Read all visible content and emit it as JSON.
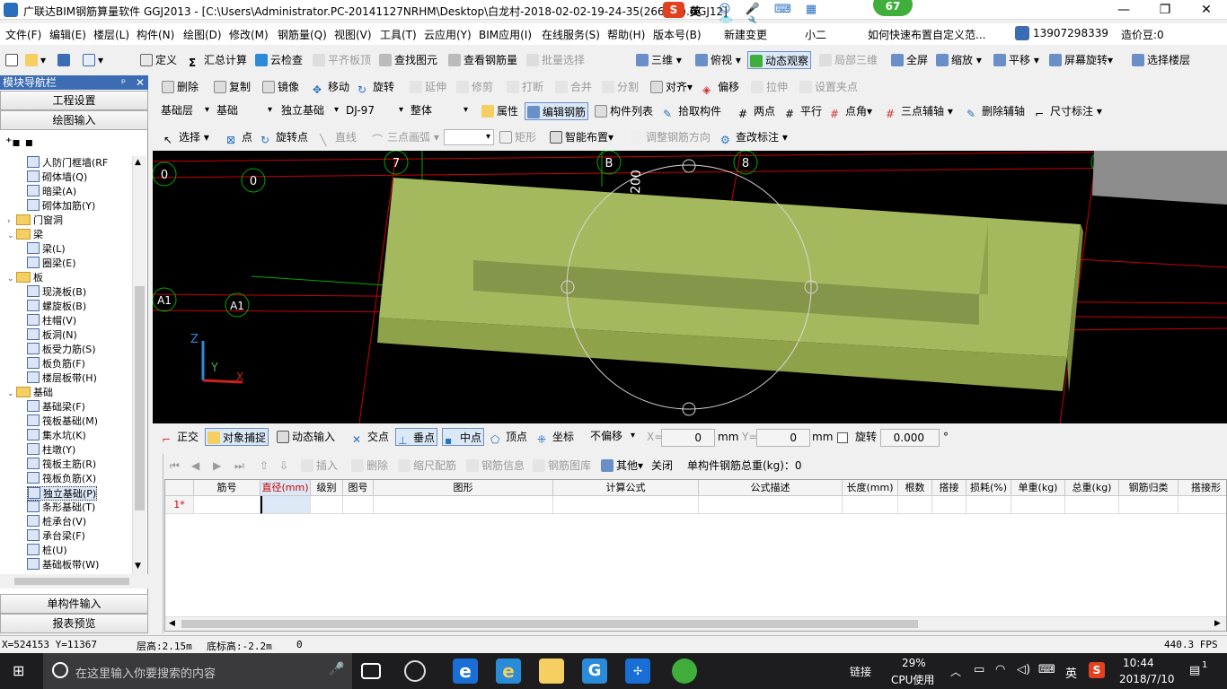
{
  "titlebar": {
    "title": "广联达BIM钢筋算量软件 GGJ2013 - [C:\\Users\\Administrator.PC-20141127NRHM\\Desktop\\白龙村-2018-02-02-19-24-35(2666版).GGJ12]",
    "ime": "英",
    "badge": "67",
    "minimize": "—",
    "restore": "❐",
    "close": "✕"
  },
  "menubar": {
    "items": [
      "文件(F)",
      "编辑(E)",
      "楼层(L)",
      "构件(N)",
      "绘图(D)",
      "修改(M)",
      "钢筋量(Q)",
      "视图(V)",
      "工具(T)",
      "云应用(Y)",
      "BIM应用(I)",
      "在线服务(S)",
      "帮助(H)",
      "版本号(B)",
      "新建变更",
      "小二"
    ],
    "tip": "如何快速布置自定义范...",
    "phone": "13907298339",
    "douzi": "造价豆:0"
  },
  "toolbar1": {
    "items": [
      "定义",
      "汇总计算",
      "云检查",
      "平齐板顶",
      "查找图元",
      "查看钢筋量",
      "批量选择",
      "三维",
      "俯视",
      "动态观察",
      "局部三维",
      "全屏",
      "缩放",
      "平移",
      "屏幕旋转",
      "选择楼层"
    ]
  },
  "toolbar2": {
    "items": [
      "删除",
      "复制",
      "镜像",
      "移动",
      "旋转",
      "延伸",
      "修剪",
      "打断",
      "合并",
      "分割",
      "对齐",
      "偏移",
      "拉伸",
      "设置夹点"
    ]
  },
  "toolbar3": {
    "floor": "基础层",
    "category": "基础",
    "type": "独立基础",
    "name": "DJ-97",
    "part": "整体",
    "items": [
      "属性",
      "编辑钢筋",
      "构件列表",
      "拾取构件",
      "两点",
      "平行",
      "点角",
      "三点辅轴",
      "删除辅轴",
      "尺寸标注"
    ]
  },
  "toolbar4": {
    "items": [
      "选择",
      "点",
      "旋转点",
      "直线",
      "三点画弧",
      "矩形",
      "智能布置",
      "调整钢筋方向",
      "查改标注"
    ]
  },
  "nav": {
    "title": "模块导航栏",
    "pin": "ᵖ",
    "close": "✕",
    "tab1": "工程设置",
    "tab2": "绘图输入",
    "tree": [
      {
        "label": "人防门框墙(RF",
        "level": 2
      },
      {
        "label": "砌体墙(Q)",
        "level": 2
      },
      {
        "label": "暗梁(A)",
        "level": 2
      },
      {
        "label": "砌体加筋(Y)",
        "level": 2
      },
      {
        "label": "门窗洞",
        "level": 1,
        "toggle": "›"
      },
      {
        "label": "梁",
        "level": 1,
        "toggle": "⌄"
      },
      {
        "label": "梁(L)",
        "level": 2
      },
      {
        "label": "圈梁(E)",
        "level": 2
      },
      {
        "label": "板",
        "level": 1,
        "toggle": "⌄"
      },
      {
        "label": "现浇板(B)",
        "level": 2
      },
      {
        "label": "螺旋板(B)",
        "level": 2
      },
      {
        "label": "柱帽(V)",
        "level": 2
      },
      {
        "label": "板洞(N)",
        "level": 2
      },
      {
        "label": "板受力筋(S)",
        "level": 2
      },
      {
        "label": "板负筋(F)",
        "level": 2
      },
      {
        "label": "楼层板带(H)",
        "level": 2
      },
      {
        "label": "基础",
        "level": 1,
        "toggle": "⌄"
      },
      {
        "label": "基础梁(F)",
        "level": 2
      },
      {
        "label": "筏板基础(M)",
        "level": 2
      },
      {
        "label": "集水坑(K)",
        "level": 2
      },
      {
        "label": "柱墩(Y)",
        "level": 2
      },
      {
        "label": "筏板主筋(R)",
        "level": 2
      },
      {
        "label": "筏板负筋(X)",
        "level": 2
      },
      {
        "label": "独立基础(P)",
        "level": 2,
        "selected": true
      },
      {
        "label": "条形基础(T)",
        "level": 2
      },
      {
        "label": "桩承台(V)",
        "level": 2
      },
      {
        "label": "承台梁(F)",
        "level": 2
      },
      {
        "label": "桩(U)",
        "level": 2
      },
      {
        "label": "基础板带(W)",
        "level": 2
      }
    ],
    "bottom1": "单构件输入",
    "bottom2": "报表预览"
  },
  "viewport": {
    "axis_labels": {
      "top": [
        "7",
        "B",
        "8"
      ],
      "left": [
        "0",
        "0",
        "A1",
        "A1"
      ]
    },
    "dim_text": "200",
    "axis_z": "Z",
    "axis_y": "Y",
    "axis_x": "X"
  },
  "snapbar": {
    "items": [
      "正交",
      "对象捕捉",
      "动态输入",
      "交点",
      "垂点",
      "中点",
      "顶点",
      "坐标"
    ],
    "offset_mode": "不偏移",
    "x_label": "X=",
    "x_value": "0",
    "y_label": "Y=",
    "y_value": "0",
    "unit": "mm",
    "rotate_label": "旋转",
    "rotate_value": "0.000",
    "deg": "°"
  },
  "rebarbar": {
    "items": [
      "插入",
      "删除",
      "缩尺配筋",
      "钢筋信息",
      "钢筋图库",
      "其他",
      "关闭"
    ],
    "total": "单构件钢筋总重(kg)：0"
  },
  "grid": {
    "columns": [
      "筋号",
      "直径(mm)",
      "级别",
      "图号",
      "图形",
      "计算公式",
      "公式描述",
      "长度(mm)",
      "根数",
      "搭接",
      "损耗(%)",
      "单重(kg)",
      "总重(kg)",
      "钢筋归类",
      "搭接形"
    ],
    "row1": "1*"
  },
  "status": {
    "coords": "X=524153 Y=11367",
    "floor_height": "层高:2.15m",
    "base_height": "底标高:-2.2m",
    "value": "0",
    "fps": "440.3 FPS"
  },
  "taskbar": {
    "search": "在这里输入你要搜索的内容",
    "link": "链接",
    "cpu_pct": "29%",
    "cpu_label": "CPU使用",
    "ime": "英",
    "time": "10:44",
    "date": "2018/7/10",
    "notify": "1"
  }
}
